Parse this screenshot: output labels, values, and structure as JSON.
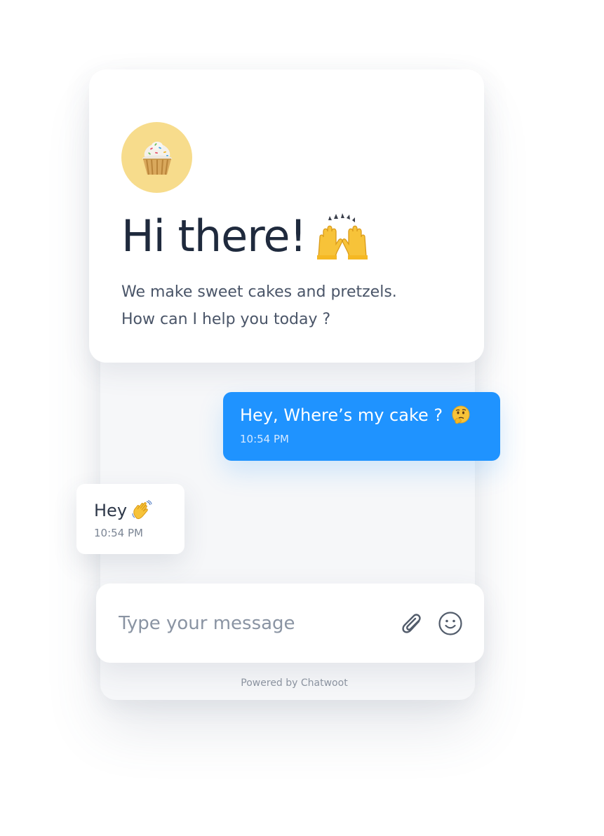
{
  "header": {
    "avatar_icon": "cupcake-icon",
    "title": "Hi there!",
    "title_emoji_icon": "raising-hands-icon",
    "intro_line_1": "We make sweet cakes and pretzels.",
    "intro_line_2": "How can I help you today ?"
  },
  "messages": [
    {
      "direction": "outgoing",
      "text": "Hey, Where’s my cake ?",
      "emoji_icon": "thinking-face-icon",
      "time": "10:54 PM"
    },
    {
      "direction": "incoming",
      "text": "Hey",
      "emoji_icon": "waving-hand-icon",
      "time": "10:54 PM"
    }
  ],
  "composer": {
    "placeholder": "Type your message",
    "value": "",
    "attach_icon": "paperclip-icon",
    "emoji_icon": "smiley-icon"
  },
  "footer": {
    "powered_by": "Powered by Chatwoot"
  },
  "colors": {
    "accent": "#1f93ff",
    "avatar_bg": "#f7dc8c",
    "title_text": "#1f2a3d"
  }
}
